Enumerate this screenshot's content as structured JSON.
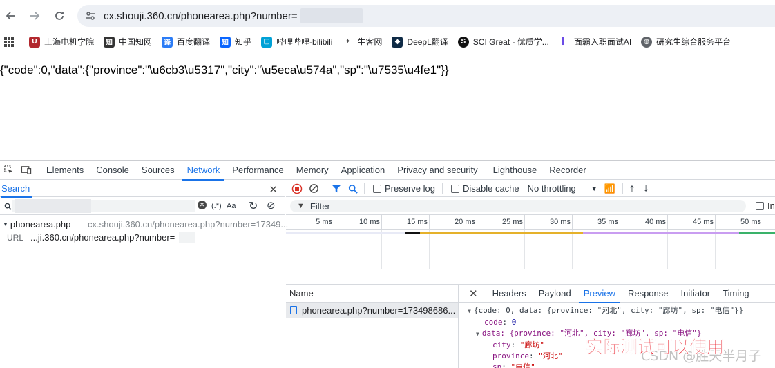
{
  "browser": {
    "url": "cx.shouji.360.cn/phonearea.php?number=",
    "bookmarks": [
      {
        "label": "上海电机学院",
        "icon": "sdju-icon",
        "color": "#b2282e"
      },
      {
        "label": "中国知网",
        "icon": "cnki-icon",
        "color": "#333333"
      },
      {
        "label": "百度翻译",
        "icon": "baidu-translate-icon",
        "color": "#2b7cf6"
      },
      {
        "label": "知乎",
        "icon": "zhihu-icon",
        "color": "#0a66ff"
      },
      {
        "label": "哔哩哔哩-bilibili",
        "icon": "bilibili-icon",
        "color": "#00a1d6"
      },
      {
        "label": "牛客网",
        "icon": "nowcoder-icon",
        "color": "#4b4b4b"
      },
      {
        "label": "DeepL翻译",
        "icon": "deepl-icon",
        "color": "#0f2b46"
      },
      {
        "label": "SCI Great - 优质学...",
        "icon": "sci-great-icon",
        "color": "#111111"
      },
      {
        "label": "面霸入职面试AI",
        "icon": "interview-ai-icon",
        "color": "#6b4ce6"
      },
      {
        "label": "研究生综合服务平台",
        "icon": "globe-icon",
        "color": "#5f6368"
      }
    ]
  },
  "page": {
    "json_text": "{\"code\":0,\"data\":{\"province\":\"\\u6cb3\\u5317\",\"city\":\"\\u5eca\\u574a\",\"sp\":\"\\u7535\\u4fe1\"}}"
  },
  "devtools": {
    "tabs": [
      "Elements",
      "Console",
      "Sources",
      "Network",
      "Performance",
      "Memory",
      "Application",
      "Privacy and security",
      "Lighthouse",
      "Recorder"
    ],
    "active_tab": "Network",
    "search": {
      "title": "Search",
      "regex_label": "(.*)",
      "case_label": "Aa",
      "result_file": "phonearea.php",
      "result_path": "cx.shouji.360.cn/phonearea.php?number=17349...",
      "url_label": "URL",
      "url_value": "...ji.360.cn/phonearea.php?number="
    },
    "network": {
      "preserve_log": "Preserve log",
      "disable_cache": "Disable cache",
      "throttling": "No throttling",
      "filter_placeholder": "Filter",
      "invert_label": "In",
      "ticks": [
        "5 ms",
        "10 ms",
        "15 ms",
        "20 ms",
        "25 ms",
        "30 ms",
        "35 ms",
        "40 ms",
        "45 ms",
        "50 ms"
      ],
      "name_header": "Name",
      "request_name": "phonearea.php?number=173498686...",
      "detail_tabs": [
        "Headers",
        "Payload",
        "Preview",
        "Response",
        "Initiator",
        "Timing"
      ],
      "active_detail_tab": "Preview"
    },
    "preview": {
      "root_line": "{code: 0, data: {province: \"河北\", city: \"廊坊\", sp: \"电信\"}}",
      "code_key": "code",
      "code_value": "0",
      "data_line": "data: {province: \"河北\", city: \"廊坊\", sp: \"电信\"}",
      "city_key": "city",
      "city_value": "\"廊坊\"",
      "province_key": "province",
      "province_value": "\"河北\"",
      "sp_key": "sp",
      "sp_value": "\"电信\""
    }
  },
  "overlay": {
    "caption": "实际测试可以使用",
    "watermark": "CSDN @胜天半月子"
  }
}
